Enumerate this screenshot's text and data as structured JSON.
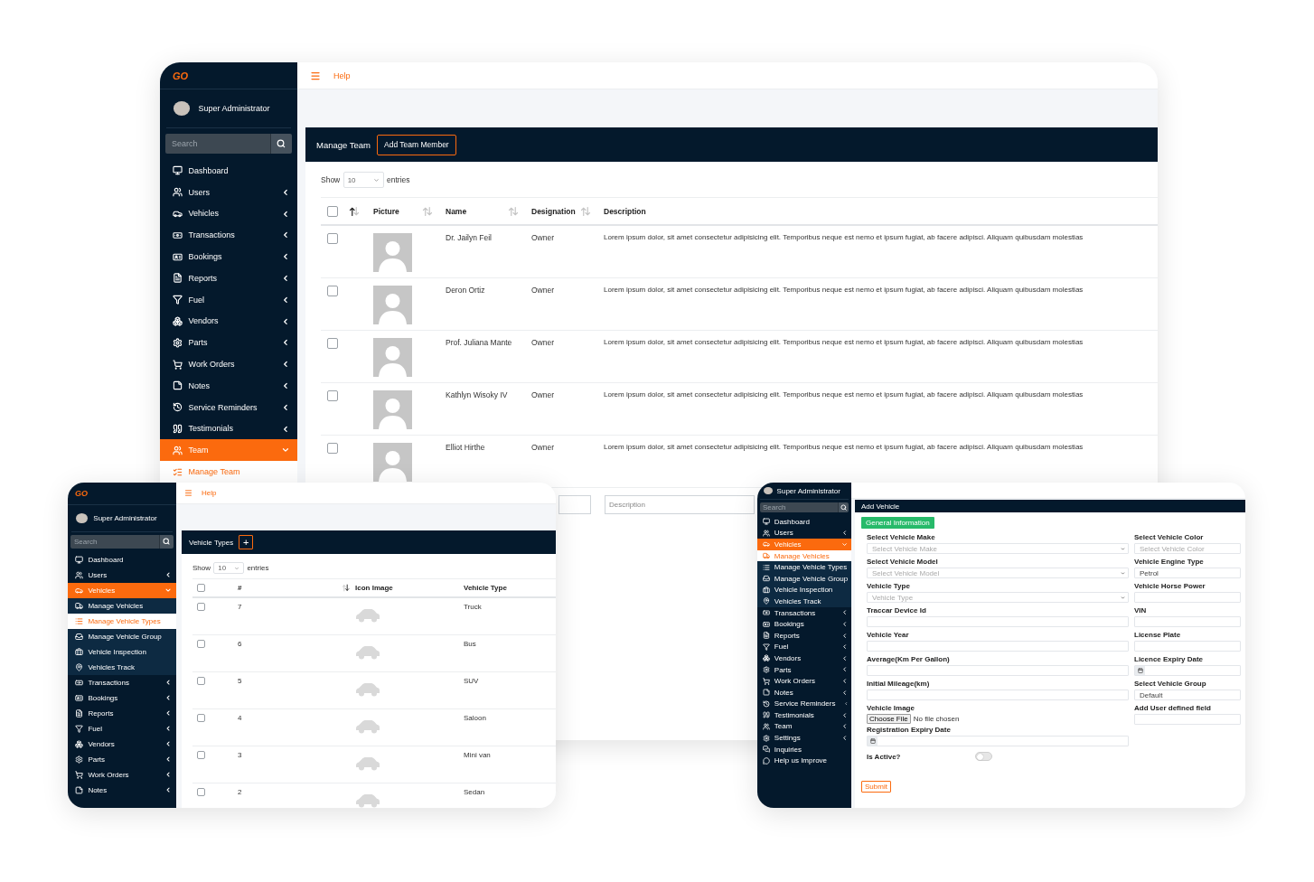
{
  "back_window": {
    "brand": "GO",
    "user": "Super Administrator",
    "search_placeholder": "Search",
    "help": "Help",
    "sidebar": [
      {
        "label": "Dashboard",
        "selected": false
      },
      {
        "label": "Users",
        "expanded": false,
        "selected": false
      },
      {
        "label": "Vehicles",
        "expanded": false,
        "selected": false
      },
      {
        "label": "Transactions",
        "expanded": false,
        "selected": false
      },
      {
        "label": "Bookings",
        "expanded": false,
        "selected": false
      },
      {
        "label": "Reports",
        "expanded": false,
        "selected": false
      },
      {
        "label": "Fuel",
        "expanded": false,
        "selected": false
      },
      {
        "label": "Vendors",
        "expanded": false,
        "selected": false
      },
      {
        "label": "Parts",
        "expanded": false,
        "selected": false
      },
      {
        "label": "Work Orders",
        "expanded": false,
        "selected": false
      },
      {
        "label": "Notes",
        "expanded": false,
        "selected": false
      },
      {
        "label": "Service Reminders",
        "expanded": false,
        "selected": false
      },
      {
        "label": "Testimonials",
        "expanded": false,
        "selected": false
      },
      {
        "label": "Team",
        "expanded": true,
        "selected": true,
        "children": [
          {
            "label": "Manage Team",
            "selected": true
          }
        ]
      }
    ],
    "card_title": "Manage Team",
    "add_button": "Add Team Member",
    "length": {
      "show": "Show",
      "value": "10",
      "entries": "entries"
    },
    "header_checkbox": {
      "checked": false,
      "sortable": true,
      "sorted_up": true,
      "sorted_down": false
    },
    "columns": [
      {
        "label": "Picture",
        "sortable": true,
        "sorted_up": false,
        "sorted_down": false
      },
      {
        "label": "Name",
        "sortable": true,
        "sorted_up": false,
        "sorted_down": false
      },
      {
        "label": "Designation",
        "sortable": true,
        "sorted_up": false,
        "sorted_down": false
      },
      {
        "label": "Description",
        "sortable": false
      }
    ],
    "rows": [
      {
        "checked": false,
        "name": "Dr. Jailyn Feil",
        "designation": "Owner",
        "description": "Lorem ipsum dolor, sit amet consectetur adipisicing elit. Temporibus neque est nemo et ipsum fugiat, ab facere adipisci. Aliquam quibusdam molestias"
      },
      {
        "checked": false,
        "name": "Deron Ortiz",
        "designation": "Owner",
        "description": "Lorem ipsum dolor, sit amet consectetur adipisicing elit. Temporibus neque est nemo et ipsum fugiat, ab facere adipisci. Aliquam quibusdam molestias"
      },
      {
        "checked": false,
        "name": "Prof. Juliana Mante",
        "designation": "Owner",
        "description": "Lorem ipsum dolor, sit amet consectetur adipisicing elit. Temporibus neque est nemo et ipsum fugiat, ab facere adipisci. Aliquam quibusdam molestias"
      },
      {
        "checked": false,
        "name": "Kathlyn Wisoky IV",
        "designation": "Owner",
        "description": "Lorem ipsum dolor, sit amet consectetur adipisicing elit. Temporibus neque est nemo et ipsum fugiat, ab facere adipisci. Aliquam quibusdam molestias"
      },
      {
        "checked": false,
        "name": "Elliot Hirthe",
        "designation": "Owner",
        "description": "Lorem ipsum dolor, sit amet consectetur adipisicing elit. Temporibus neque est nemo et ipsum fugiat, ab facere adipisci. Aliquam quibusdam molestias"
      }
    ],
    "filters": {
      "description_placeholder": "Description"
    }
  },
  "left_window": {
    "brand": "GO",
    "user": "Super Administrator",
    "search_placeholder": "Search",
    "help": "Help",
    "sidebar": [
      {
        "label": "Dashboard",
        "selected": false
      },
      {
        "label": "Users",
        "expanded": false,
        "selected": false
      },
      {
        "label": "Vehicles",
        "expanded": true,
        "selected": true,
        "children": [
          {
            "label": "Manage Vehicles",
            "selected": false
          },
          {
            "label": "Manage Vehicle Types",
            "selected": true
          },
          {
            "label": "Manage Vehicle Group",
            "selected": false
          },
          {
            "label": "Vehicle Inspection",
            "selected": false
          },
          {
            "label": "Vehicles Track",
            "selected": false
          }
        ]
      },
      {
        "label": "Transactions",
        "expanded": false,
        "selected": false
      },
      {
        "label": "Bookings",
        "expanded": false,
        "selected": false
      },
      {
        "label": "Reports",
        "expanded": false,
        "selected": false
      },
      {
        "label": "Fuel",
        "expanded": false,
        "selected": false
      },
      {
        "label": "Vendors",
        "expanded": false,
        "selected": false
      },
      {
        "label": "Parts",
        "expanded": false,
        "selected": false
      },
      {
        "label": "Work Orders",
        "expanded": false,
        "selected": false
      },
      {
        "label": "Notes",
        "expanded": false,
        "selected": false
      }
    ],
    "card_title": "Vehicle Types",
    "add_button": "+",
    "length": {
      "show": "Show",
      "value": "10",
      "entries": "entries"
    },
    "header_checkbox": {
      "checked": false
    },
    "columns": [
      {
        "label": "#",
        "sortable": true,
        "sorted_up": false,
        "sorted_down": true
      },
      {
        "label": "Icon Image",
        "sortable": false
      },
      {
        "label": "Vehicle Type",
        "sortable": false
      }
    ],
    "rows": [
      {
        "checked": false,
        "number": "7",
        "type": "Truck"
      },
      {
        "checked": false,
        "number": "6",
        "type": "Bus"
      },
      {
        "checked": false,
        "number": "5",
        "type": "SUV"
      },
      {
        "checked": false,
        "number": "4",
        "type": "Saloon"
      },
      {
        "checked": false,
        "number": "3",
        "type": "Mini van"
      },
      {
        "checked": false,
        "number": "2",
        "type": "Sedan"
      }
    ]
  },
  "right_window": {
    "user": "Super Administrator",
    "search_placeholder": "Search",
    "sidebar": [
      {
        "label": "Dashboard",
        "selected": false
      },
      {
        "label": "Users",
        "expanded": false,
        "selected": false
      },
      {
        "label": "Vehicles",
        "expanded": true,
        "selected": true,
        "children": [
          {
            "label": "Manage Vehicles",
            "selected": true
          },
          {
            "label": "Manage Vehicle Types",
            "selected": false
          },
          {
            "label": "Manage Vehicle Group",
            "selected": false
          },
          {
            "label": "Vehicle Inspection",
            "selected": false
          },
          {
            "label": "Vehicles Track",
            "selected": false
          }
        ]
      },
      {
        "label": "Transactions",
        "expanded": false,
        "selected": false
      },
      {
        "label": "Bookings",
        "expanded": false,
        "selected": false
      },
      {
        "label": "Reports",
        "expanded": false,
        "selected": false
      },
      {
        "label": "Fuel",
        "expanded": false,
        "selected": false
      },
      {
        "label": "Vendors",
        "expanded": false,
        "selected": false
      },
      {
        "label": "Parts",
        "expanded": false,
        "selected": false
      },
      {
        "label": "Work Orders",
        "expanded": false,
        "selected": false
      },
      {
        "label": "Notes",
        "expanded": false,
        "selected": false
      },
      {
        "label": "Service Reminders",
        "expanded": false,
        "selected": false
      },
      {
        "label": "Testimonials",
        "expanded": false,
        "selected": false
      },
      {
        "label": "Team",
        "expanded": false,
        "selected": false
      },
      {
        "label": "Settings",
        "expanded": false,
        "selected": false
      },
      {
        "label": "Inquiries",
        "selected": false
      },
      {
        "label": "Help us Improve",
        "selected": false
      }
    ],
    "card_title": "Add Vehicle",
    "tab": "General Information",
    "left_fields": [
      {
        "kind": "select",
        "label": "Select Vehicle Make",
        "placeholder": "Select Vehicle Make"
      },
      {
        "kind": "select",
        "label": "Select Vehicle Model",
        "placeholder": "Select Vehicle Model"
      },
      {
        "kind": "select",
        "label": "Vehicle Type",
        "placeholder": "Vehicle Type"
      },
      {
        "kind": "text",
        "label": "Traccar Device Id"
      },
      {
        "kind": "text",
        "label": "Vehicle Year"
      },
      {
        "kind": "text",
        "label": "Average(Km Per Gallon)"
      },
      {
        "kind": "text",
        "label": "Initial Mileage(km)"
      },
      {
        "kind": "file",
        "label": "Vehicle Image",
        "button": "Choose File",
        "status": "No file chosen"
      },
      {
        "kind": "date",
        "label": "Registration Expiry Date"
      },
      {
        "kind": "toggle",
        "label": "Is Active?",
        "on": false
      }
    ],
    "right_fields": [
      {
        "kind": "text",
        "label": "Select Vehicle Color",
        "placeholder": "Select Vehicle Color"
      },
      {
        "kind": "text",
        "label": "Vehicle Engine Type",
        "value": "Petrol"
      },
      {
        "kind": "text",
        "label": "Vehicle Horse Power"
      },
      {
        "kind": "text",
        "label": "VIN"
      },
      {
        "kind": "text",
        "label": "License Plate"
      },
      {
        "kind": "date",
        "label": "Licence Expiry Date"
      },
      {
        "kind": "text",
        "label": "Select Vehicle Group",
        "value": "Default"
      },
      {
        "kind": "text",
        "label": "Add User defined field"
      }
    ],
    "submit": "Submit"
  }
}
